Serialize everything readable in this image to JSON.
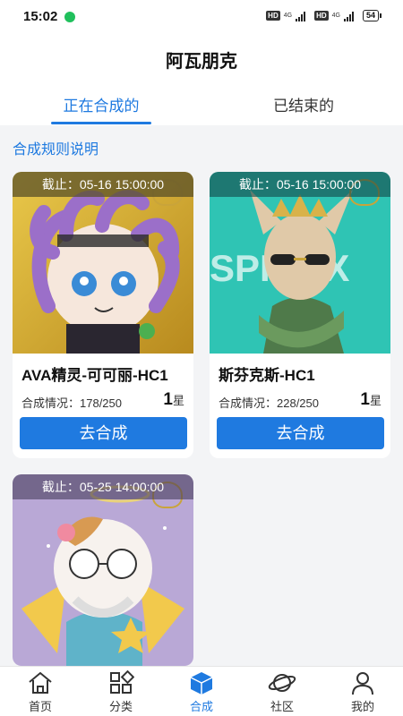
{
  "status_bar": {
    "time": "15:02",
    "hd1": "HD",
    "net1": "4G",
    "hd2": "HD",
    "net2": "4G",
    "battery": "54"
  },
  "header": {
    "title": "阿瓦朋克",
    "tabs": [
      {
        "label": "正在合成的",
        "active": true
      },
      {
        "label": "已结束的",
        "active": false
      }
    ]
  },
  "rules_link": "合成规则说明",
  "cards": [
    {
      "deadline": "截止：05-16 15:00:00",
      "name": "AVA精灵-可可丽-HC1",
      "progress": "合成情况：178/250",
      "stars_count": "1",
      "stars_unit": "星",
      "button": "去合成"
    },
    {
      "deadline": "截止：05-16 15:00:00",
      "name": "斯芬克斯-HC1",
      "progress": "合成情况：228/250",
      "stars_count": "1",
      "stars_unit": "星",
      "button": "去合成",
      "background_text": "SPHINX"
    },
    {
      "deadline": "截止：05-25 14:00:00"
    }
  ],
  "bottom_nav": [
    {
      "label": "首页",
      "icon": "home-icon"
    },
    {
      "label": "分类",
      "icon": "grid-icon"
    },
    {
      "label": "合成",
      "icon": "cube-icon",
      "active": true
    },
    {
      "label": "社区",
      "icon": "planet-icon"
    },
    {
      "label": "我的",
      "icon": "person-icon"
    }
  ],
  "colors": {
    "accent": "#1f7ae0",
    "page_bg": "#f3f4f6"
  }
}
